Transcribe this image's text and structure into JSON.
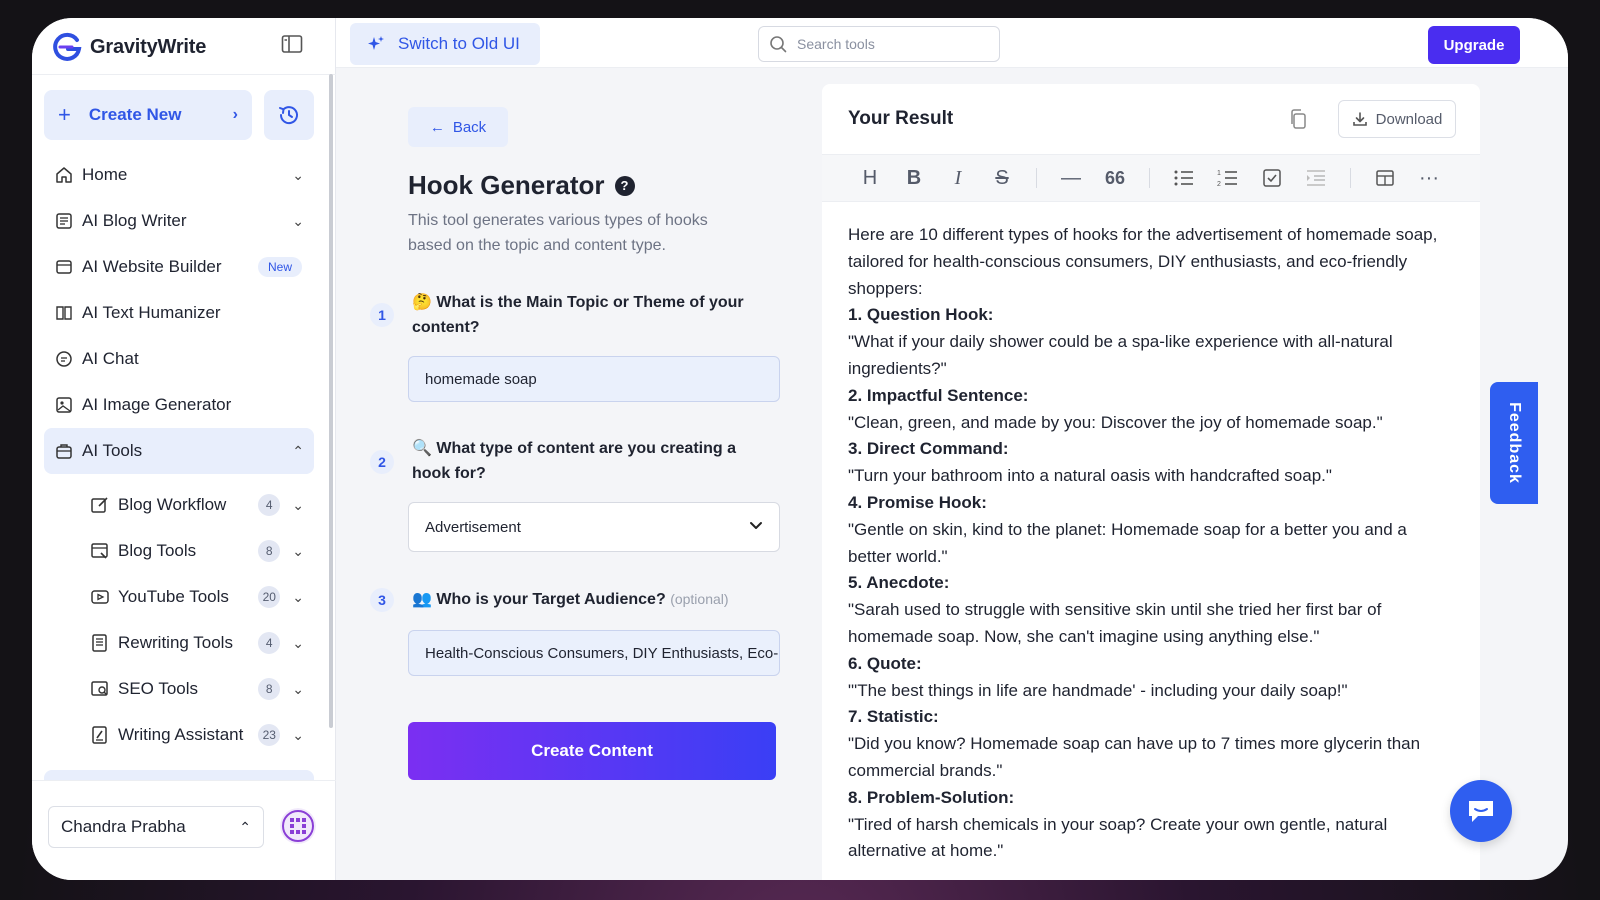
{
  "app": {
    "name": "GravityWrite"
  },
  "sidebar": {
    "create_label": "Create New",
    "items": [
      {
        "label": "Home",
        "icon": "home-icon",
        "has_caret": true
      },
      {
        "label": "AI Blog Writer",
        "icon": "document-icon",
        "has_caret": true
      },
      {
        "label": "AI Website Builder",
        "icon": "browser-icon",
        "badge": "New"
      },
      {
        "label": "AI Text Humanizer",
        "icon": "book-icon"
      },
      {
        "label": "AI Chat",
        "icon": "chat-icon"
      },
      {
        "label": "AI Image Generator",
        "icon": "image-icon"
      },
      {
        "label": "AI Tools",
        "icon": "toolbox-icon",
        "expanded": true
      }
    ],
    "tools": [
      {
        "label": "Blog Workflow",
        "count": "4"
      },
      {
        "label": "Blog Tools",
        "count": "8"
      },
      {
        "label": "YouTube Tools",
        "count": "20"
      },
      {
        "label": "Rewriting Tools",
        "count": "4"
      },
      {
        "label": "SEO Tools",
        "count": "8"
      },
      {
        "label": "Writing Assistant",
        "count": "23"
      }
    ],
    "user_name": "Chandra Prabha"
  },
  "topbar": {
    "switch_label": "Switch to Old UI",
    "search_placeholder": "Search tools",
    "upgrade_label": "Upgrade"
  },
  "form": {
    "back_label": "Back",
    "title": "Hook Generator",
    "description": "This tool generates various types of hooks based on the topic and content type.",
    "questions": [
      {
        "num": "1",
        "emoji": "🤔",
        "text": "What is the Main Topic or Theme of your content?",
        "value": "homemade soap"
      },
      {
        "num": "2",
        "emoji": "🔍",
        "text": "What type of content are you creating a hook for?",
        "value": "Advertisement"
      },
      {
        "num": "3",
        "emoji": "👥",
        "text": "Who is your Target Audience?",
        "optional": "(optional)",
        "value": "Health-Conscious Consumers, DIY Enthusiasts, Eco-Friendly Shoppers"
      }
    ],
    "submit_label": "Create Content"
  },
  "result": {
    "title": "Your Result",
    "download_label": "Download",
    "intro": "Here are 10 different types of hooks for the advertisement of homemade soap, tailored for health-conscious consumers, DIY enthusiasts, and eco-friendly shoppers:",
    "hooks": [
      {
        "heading": "1. Question Hook:",
        "text": "\"What if your daily shower could be a spa-like experience with all-natural ingredients?\""
      },
      {
        "heading": "2. Impactful Sentence:",
        "text": "\"Clean, green, and made by you: Discover the joy of homemade soap.\""
      },
      {
        "heading": "3. Direct Command:",
        "text": "\"Turn your bathroom into a natural oasis with handcrafted soap.\""
      },
      {
        "heading": "4. Promise Hook:",
        "text": "\"Gentle on skin, kind to the planet: Homemade soap for a better you and a better world.\""
      },
      {
        "heading": "5. Anecdote:",
        "text": "\"Sarah used to struggle with sensitive skin until she tried her first bar of homemade soap. Now, she can't imagine using anything else.\""
      },
      {
        "heading": "6. Quote:",
        "text": "\"'The best things in life are handmade' - including your daily soap!\""
      },
      {
        "heading": "7. Statistic:",
        "text": "\"Did you know? Homemade soap can have up to 7 times more glycerin than commercial brands.\""
      },
      {
        "heading": "8. Problem-Solution:",
        "text": "\"Tired of harsh chemicals in your soap? Create your own gentle, natural alternative at home.\""
      }
    ]
  },
  "feedback_label": "Feedback",
  "colors": {
    "accent": "#3056e6",
    "upgrade": "#4a2df0",
    "feedback": "#2f5ef0"
  }
}
